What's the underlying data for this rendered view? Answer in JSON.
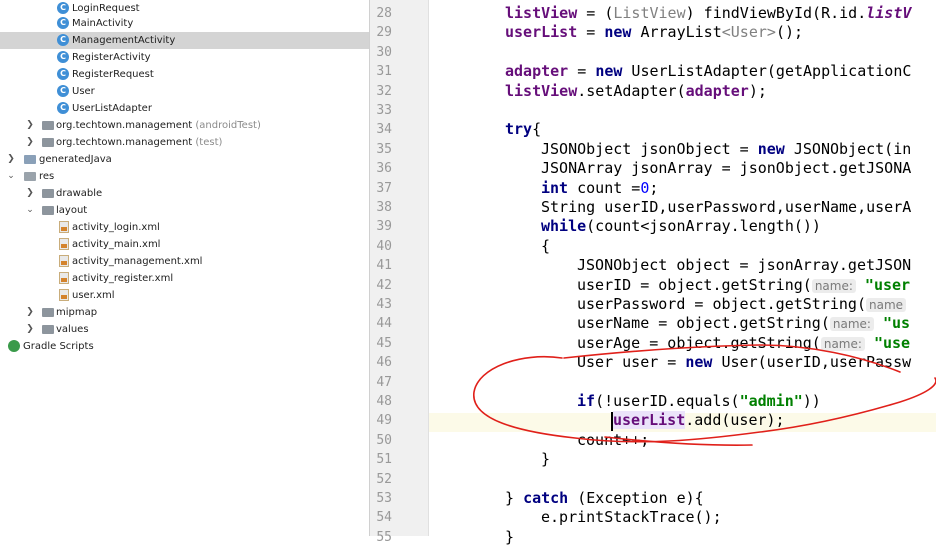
{
  "tree": {
    "classes": [
      "LoginRequest",
      "MainActivity",
      "ManagementActivity",
      "RegisterActivity",
      "RegisterRequest",
      "User",
      "UserListAdapter"
    ],
    "selected_class": "ManagementActivity",
    "class_icon_letter": "C",
    "pkg_android_test": {
      "name": "org.techtown.management",
      "suffix": "(androidTest)"
    },
    "pkg_test": {
      "name": "org.techtown.management",
      "suffix": "(test)"
    },
    "generated_java": "generatedJava",
    "res": "res",
    "drawable": "drawable",
    "layout": "layout",
    "layout_files": [
      "activity_login.xml",
      "activity_main.xml",
      "activity_management.xml",
      "activity_register.xml",
      "user.xml"
    ],
    "mipmap": "mipmap",
    "values": "values",
    "gradle_scripts": "Gradle Scripts",
    "colors": {
      "selected_bg": "#d4d4d4",
      "class_icon": "#3f8fd6",
      "folder_icon": "#8d959d"
    }
  },
  "editor": {
    "line_numbers": [
      "28",
      "29",
      "30",
      "31",
      "32",
      "33",
      "34",
      "35",
      "36",
      "37",
      "38",
      "39",
      "40",
      "41",
      "42",
      "43",
      "44",
      "45",
      "46",
      "47",
      "48",
      "49",
      "50",
      "51",
      "52",
      "53",
      "54",
      "55"
    ],
    "current_line": "49",
    "code": {
      "l28a": "listView",
      "l28b": " = (",
      "l28c": "ListView",
      "l28d": ") findViewById(R.id.",
      "l28e": "listV",
      "l29a": "userList",
      "l29b": " = ",
      "l29c": "new",
      "l29d": " ArrayList",
      "l29e": "<User>",
      "l29f": "();",
      "l31a": "adapter",
      "l31b": " = ",
      "l31c": "new",
      "l31d": " UserListAdapter(getApplicationC",
      "l32a": "listView",
      "l32b": ".setAdapter(",
      "l32c": "adapter",
      "l32d": ");",
      "l34a": "try",
      "l34b": "{",
      "l35a": "JSONObject jsonObject = ",
      "l35b": "new",
      "l35c": " JSONObject(in",
      "l36": "JSONArray jsonArray = jsonObject.getJSONA",
      "l37a": "int",
      "l37b": " count =",
      "l37c": "0",
      "l37d": ";",
      "l38": "String userID,userPassword,userName,userA",
      "l39a": "while",
      "l39b": "(count<jsonArray.length())",
      "l40": "{",
      "l41": "JSONObject object = jsonArray.getJSON",
      "l42a": "userID = object.getString(",
      "l42h": "name:",
      "l42s": "\"user",
      "l43a": "userPassword = object.getString(",
      "l43h": "name",
      "l44a": "userName = object.getString(",
      "l44h": "name:",
      "l44s": "\"us",
      "l45a": "userAge = object.getString(",
      "l45h": "name:",
      "l45s": "\"use",
      "l46a": "User user = ",
      "l46b": "new",
      "l46c": " User(userID,userPassw",
      "l48a": "if",
      "l48b": "(!userID.equals(",
      "l48c": "\"admin\"",
      "l48d": "))",
      "l49a": "userList",
      "l49b": ".add(user);",
      "l50": "count++;",
      "l51": "}",
      "l53a": "} ",
      "l53b": "catch",
      "l53c": " (Exception e){",
      "l54": "e.printStackTrace();",
      "l55": "}"
    },
    "colors": {
      "keyword": "#000080",
      "field": "#660e7a",
      "string": "#008000",
      "number": "#0000ff",
      "annotation_stroke": "#e0201a"
    }
  }
}
